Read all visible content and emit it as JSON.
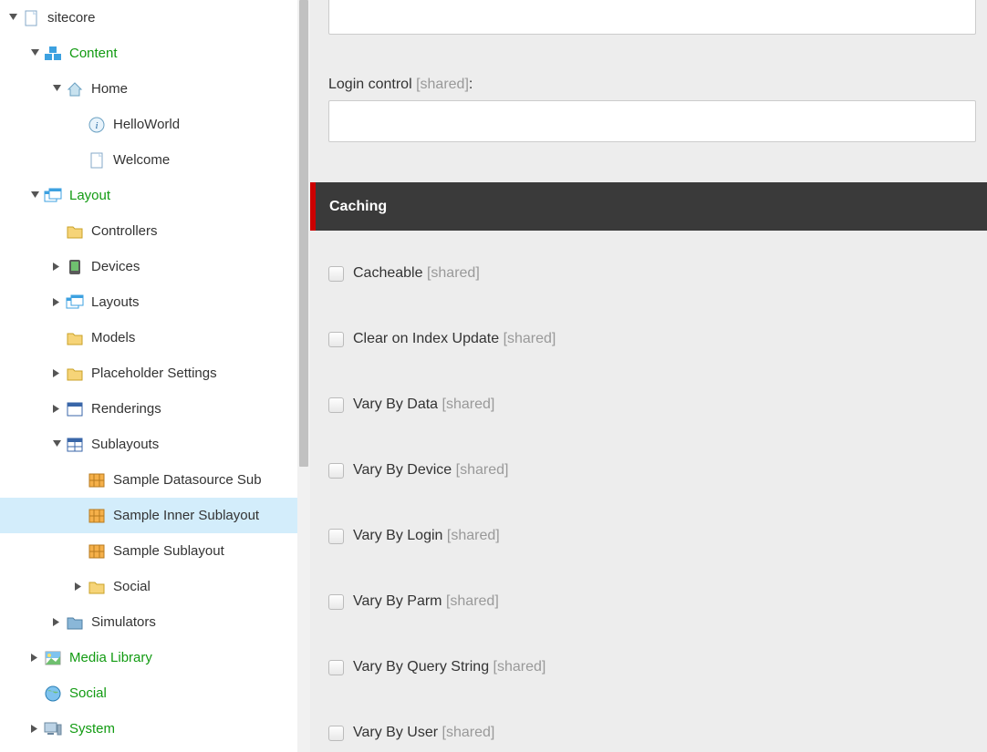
{
  "tree": {
    "root": "sitecore",
    "content": "Content",
    "home": "Home",
    "helloworld": "HelloWorld",
    "welcome": "Welcome",
    "layout": "Layout",
    "controllers": "Controllers",
    "devices": "Devices",
    "layouts": "Layouts",
    "models": "Models",
    "placeholder": "Placeholder Settings",
    "renderings": "Renderings",
    "sublayouts": "Sublayouts",
    "sample_ds_sub": "Sample Datasource Sub",
    "sample_inner_sub": "Sample Inner Sublayout",
    "sample_sub": "Sample Sublayout",
    "social_folder": "Social",
    "simulators": "Simulators",
    "media_library": "Media Library",
    "social": "Social",
    "system": "System"
  },
  "fields": {
    "login_control": "Login control",
    "shared": "[shared]"
  },
  "section": {
    "caching": "Caching"
  },
  "caching_options": {
    "cacheable": "Cacheable",
    "clear_on_index": "Clear on Index Update",
    "vary_by_data": "Vary By Data",
    "vary_by_device": "Vary By Device",
    "vary_by_login": "Vary By Login",
    "vary_by_parm": "Vary By Parm",
    "vary_by_query": "Vary By Query String",
    "vary_by_user": "Vary By User"
  }
}
